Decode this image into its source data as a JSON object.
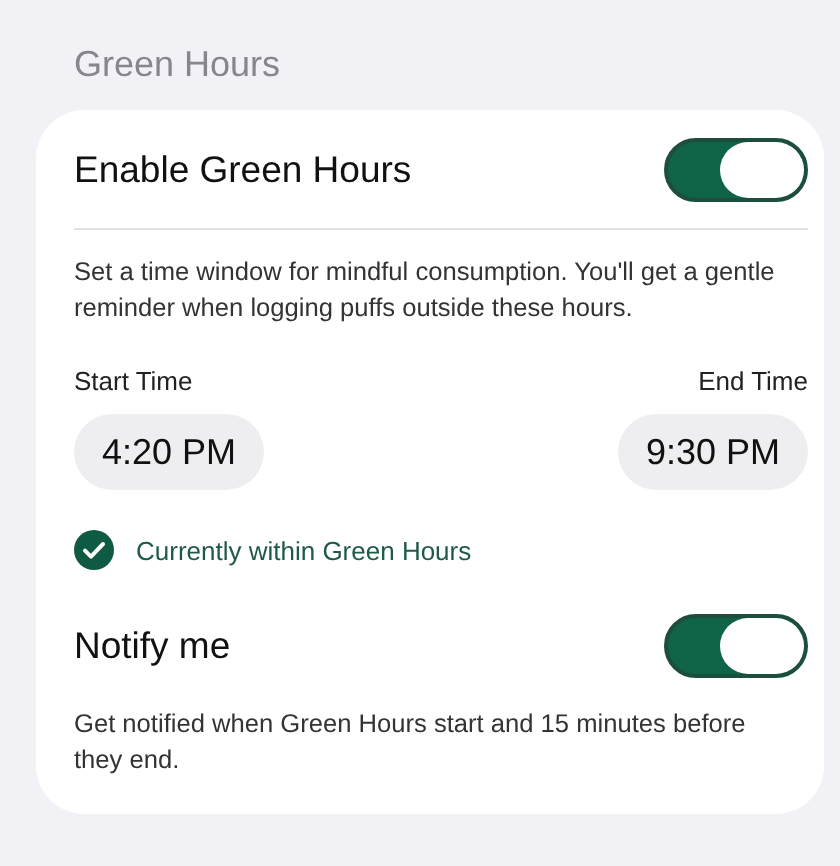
{
  "section_title": "Green Hours",
  "enable": {
    "label": "Enable Green Hours",
    "on": true
  },
  "description": "Set a time window for mindful consumption. You'll get a gentle reminder when logging puffs outside these hours.",
  "start": {
    "label": "Start Time",
    "value": "4:20 PM"
  },
  "end": {
    "label": "End Time",
    "value": "9:30 PM"
  },
  "status": {
    "text": "Currently within Green Hours",
    "active": true
  },
  "notify": {
    "label": "Notify me",
    "on": true,
    "description": "Get notified when Green Hours start and 15 minutes before they end."
  }
}
